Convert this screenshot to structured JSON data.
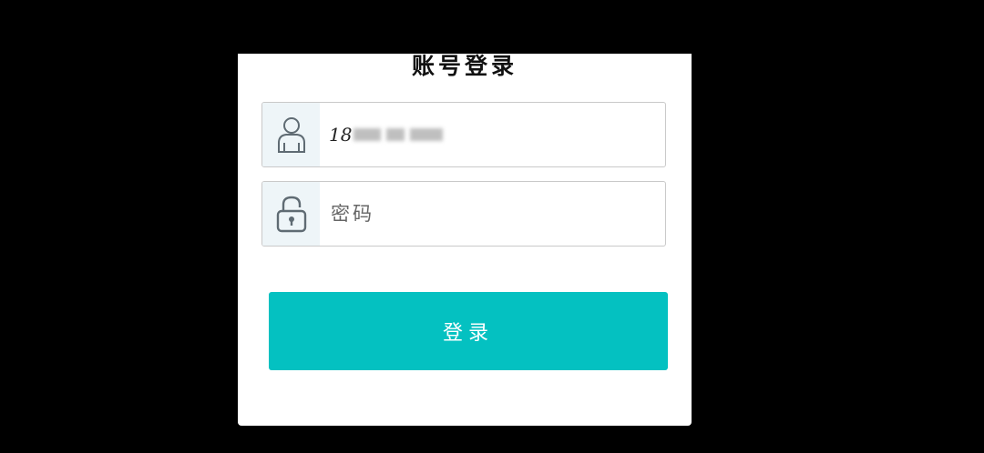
{
  "dialog": {
    "title": "账号登录"
  },
  "username": {
    "icon": "user-icon",
    "value_visible_prefix": "18"
  },
  "password": {
    "icon": "lock-icon",
    "placeholder": "密码"
  },
  "login_button": {
    "label": "登录"
  },
  "colors": {
    "accent": "#04c1c1",
    "icon_bg": "#eef5f8",
    "background": "#000000"
  }
}
